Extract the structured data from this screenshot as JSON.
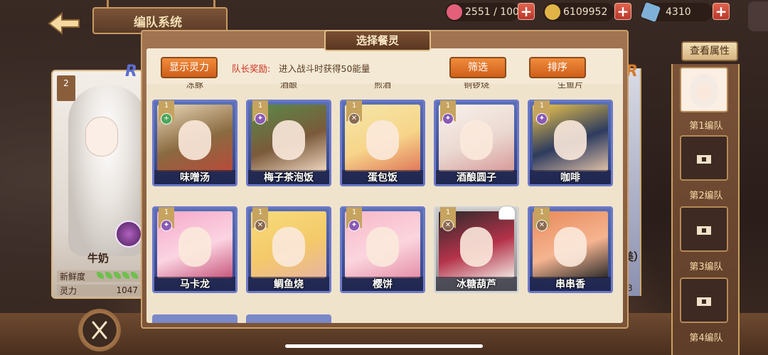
{
  "header": {
    "title": "编队系统",
    "resources": [
      {
        "icon": "heart-icon",
        "value": "2551 / 100",
        "color": "#e4607a"
      },
      {
        "icon": "coin-icon",
        "value": "6109952",
        "color": "#e0b447"
      },
      {
        "icon": "crystal-icon",
        "value": "4310",
        "color": "#7fb1d8"
      }
    ]
  },
  "left_character": {
    "rank": "2",
    "name": "牛奶",
    "freshness_label": "新鲜度",
    "power_label": "灵力",
    "power_value": "1047",
    "corner_letter": "R"
  },
  "right_peek": {
    "name_fragment": "美）",
    "number_fragment": "3",
    "corner_letter": "R"
  },
  "panel": {
    "title": "选择餐灵",
    "show_power_button": "显示灵力",
    "captain_label": "队长奖励:",
    "captain_text": "进入战斗时获得50能量",
    "filter_button": "筛选",
    "sort_button": "排序",
    "top_row_partial": [
      "冻豚",
      "酒酿",
      "煎酒",
      "铜锣烧",
      "生鱼片"
    ],
    "cards": [
      {
        "name": "味噌汤",
        "rank": "1",
        "type": "+",
        "type_color": "#4aa65a",
        "style": "blue",
        "art_colors": [
          "#e9d7b8",
          "#8a6a40",
          "#b84a3a"
        ]
      },
      {
        "name": "梅子茶泡饭",
        "rank": "1",
        "type": "✦",
        "type_color": "#8a5ab5",
        "style": "blue",
        "art_colors": [
          "#5a8a4a",
          "#7a5a3a",
          "#f0d6c0"
        ]
      },
      {
        "name": "蛋包饭",
        "rank": "1",
        "type": "✕",
        "type_color": "#8a6a50",
        "style": "blue",
        "art_colors": [
          "#f4e6a8",
          "#f7d58a",
          "#e0785a"
        ]
      },
      {
        "name": "酒酿圆子",
        "rank": "1",
        "type": "✦",
        "type_color": "#8a5ab5",
        "style": "blue",
        "art_colors": [
          "#f9f2ec",
          "#ead8d0",
          "#d89a9a"
        ]
      },
      {
        "name": "咖啡",
        "rank": "1",
        "type": "✦",
        "type_color": "#8a5ab5",
        "style": "blue",
        "art_colors": [
          "#f1c84a",
          "#2d3b5e",
          "#e2c2a8"
        ]
      },
      {
        "name": "马卡龙",
        "rank": "1",
        "type": "✦",
        "type_color": "#8a5ab5",
        "style": "blue",
        "art_colors": [
          "#f5a8c8",
          "#fbd4e2",
          "#c7567c"
        ]
      },
      {
        "name": "鲷鱼烧",
        "rank": "1",
        "type": "✕",
        "type_color": "#8a6a50",
        "style": "blue",
        "art_colors": [
          "#f7dc7a",
          "#f4c96a",
          "#e7b4a0"
        ]
      },
      {
        "name": "樱饼",
        "rank": "1",
        "type": "✦",
        "type_color": "#8a5ab5",
        "style": "blue",
        "art_colors": [
          "#f7b8c8",
          "#fbd5de",
          "#e58fa8"
        ]
      },
      {
        "name": "冰糖葫芦",
        "rank": "1",
        "type": "✕",
        "type_color": "#8a6a50",
        "style": "gray",
        "art_colors": [
          "#2a2a2a",
          "#b4324a",
          "#f1e6e0"
        ]
      },
      {
        "name": "串串香",
        "rank": "1",
        "type": "✕",
        "type_color": "#8a6a50",
        "style": "blue",
        "art_colors": [
          "#e98a5a",
          "#f5b490",
          "#2a2a2a"
        ]
      }
    ]
  },
  "sidebar": {
    "view_attributes_button": "查看属性",
    "teams": [
      "第1编队",
      "第2编队",
      "第3编队",
      "第4编队"
    ]
  }
}
